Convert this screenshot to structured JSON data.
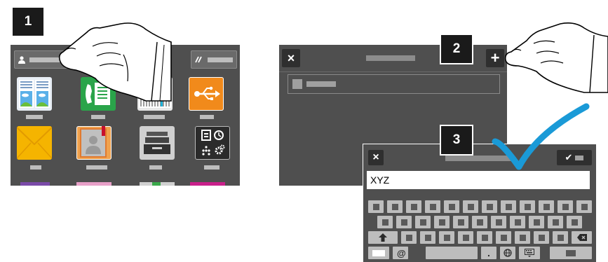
{
  "steps": {
    "one": "1",
    "two": "2",
    "three": "3"
  },
  "panel1": {
    "header_left_icon": "user-icon",
    "header_right_icon": "edit-icon",
    "tiles": [
      {
        "name": "copy-app-tile",
        "icon": "copy-icon"
      },
      {
        "name": "fax-app-tile",
        "icon": "fax-icon"
      },
      {
        "name": "scan-app-tile",
        "icon": "scan-icon"
      },
      {
        "name": "usb-app-tile",
        "icon": "usb-icon"
      },
      {
        "name": "email-app-tile",
        "icon": "envelope-icon"
      },
      {
        "name": "address-book-app-tile",
        "icon": "address-book-icon"
      },
      {
        "name": "jobs-app-tile",
        "icon": "printer-tray-icon"
      },
      {
        "name": "device-app-tile",
        "icon": "device-settings-icon"
      }
    ]
  },
  "panel2": {
    "close_icon": "×",
    "add_icon": "+"
  },
  "panel3": {
    "close_icon": "×",
    "confirm_icon": "✔",
    "input_value": "XYZ",
    "keys": {
      "at": "@",
      "period": ".",
      "globe_icon": "globe-icon",
      "keyboard_icon": "keyboard-icon",
      "shift_icon": "shift-icon",
      "backspace_icon": "backspace-icon"
    }
  },
  "colors": {
    "panel_bg": "#4f4f4f",
    "checkmark": "#1a9ad7",
    "badge_bg": "#1a1a1a",
    "usb_tile": "#f18a1b",
    "email_tile": "#f5b400"
  }
}
